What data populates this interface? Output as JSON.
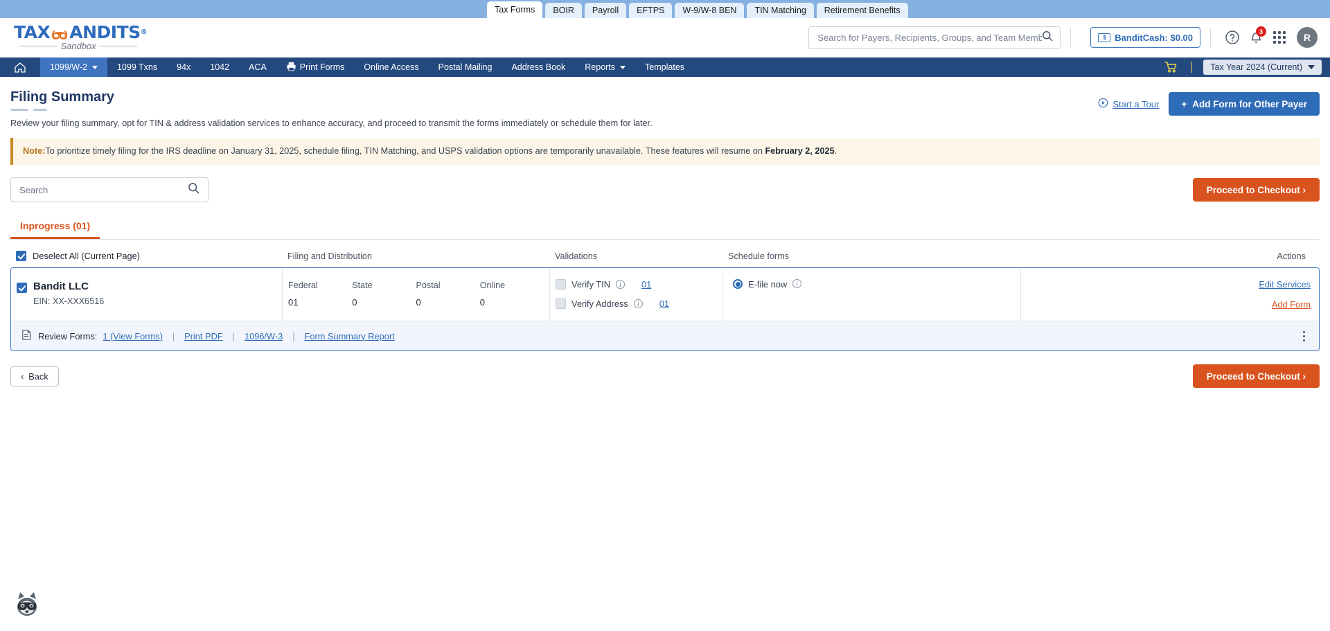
{
  "browser_tabs": [
    {
      "label": "Tax Forms",
      "active": true
    },
    {
      "label": "BOIR",
      "active": false
    },
    {
      "label": "Payroll",
      "active": false
    },
    {
      "label": "EFTPS",
      "active": false
    },
    {
      "label": "W-9/W-8 BEN",
      "active": false
    },
    {
      "label": "TIN Matching",
      "active": false
    },
    {
      "label": "Retirement Benefits",
      "active": false
    }
  ],
  "header": {
    "logo_text": "TAXBANDITS",
    "logo_registered": "®",
    "logo_sub": "Sandbox",
    "search_placeholder": "Search for Payers, Recipients, Groups, and Team Members",
    "search_value": "",
    "bandit_cash_label": "BanditCash: $0.00",
    "bandit_cash_icon_text": "$",
    "notification_count": "3",
    "avatar_initial": "R"
  },
  "nav": {
    "items": [
      {
        "label": "1099/W-2",
        "active": true,
        "caret": true
      },
      {
        "label": "1099 Txns",
        "active": false,
        "caret": false
      },
      {
        "label": "94x",
        "active": false,
        "caret": false
      },
      {
        "label": "1042",
        "active": false,
        "caret": false
      },
      {
        "label": "ACA",
        "active": false,
        "caret": false
      },
      {
        "label": "Print Forms",
        "active": false,
        "caret": false,
        "icon": "printer-icon"
      },
      {
        "label": "Online Access",
        "active": false,
        "caret": false
      },
      {
        "label": "Postal Mailing",
        "active": false,
        "caret": false
      },
      {
        "label": "Address Book",
        "active": false,
        "caret": false
      },
      {
        "label": "Reports",
        "active": false,
        "caret": true
      },
      {
        "label": "Templates",
        "active": false,
        "caret": false
      }
    ],
    "tax_year_label": "Tax Year 2024 (Current)"
  },
  "page": {
    "title": "Filing Summary",
    "subtitle": "Review your filing summary, opt for TIN & address validation services to enhance accuracy, and proceed to transmit the forms immediately or schedule them for later.",
    "tour_label": "Start a Tour",
    "add_form_label": "Add Form for Other Payer",
    "add_form_plus": "+",
    "note_label": "Note:",
    "note_text_1": "To prioritize timely filing for the IRS deadline on January 31, 2025, schedule filing, TIN Matching, and USPS validation options are temporarily unavailable. These features will resume on ",
    "note_date": "February 2, 2025",
    "note_text_2": "."
  },
  "toolbar": {
    "search_placeholder": "Search",
    "search_value": "",
    "checkout_label": "Proceed to Checkout ›"
  },
  "tabs": [
    {
      "label": "Inprogress",
      "count": "(01)",
      "active": true
    }
  ],
  "table": {
    "headers": {
      "select_all": "Deselect All (Current Page)",
      "filing": "Filing and Distribution",
      "validations": "Validations",
      "schedule": "Schedule forms",
      "actions": "Actions"
    },
    "rows": [
      {
        "selected": true,
        "payer_name": "Bandit LLC",
        "payer_ein": "EIN: XX-XXX6516",
        "filing": [
          {
            "label": "Federal",
            "value": "01"
          },
          {
            "label": "State",
            "value": "0"
          },
          {
            "label": "Postal",
            "value": "0"
          },
          {
            "label": "Online",
            "value": "0"
          }
        ],
        "validations": [
          {
            "label": "Verify TIN",
            "checked": false,
            "count": "01"
          },
          {
            "label": "Verify Address",
            "checked": false,
            "count": "01"
          }
        ],
        "schedule": {
          "label": "E-file now",
          "selected": true
        },
        "actions": [
          {
            "label": "Edit Services",
            "style": "blue"
          },
          {
            "label": "Add Form",
            "style": "orange"
          }
        ],
        "footer": {
          "review_label": "Review Forms:",
          "links": [
            {
              "label": "1 (View Forms)"
            },
            {
              "label": "Print PDF"
            },
            {
              "label": "1096/W-3"
            },
            {
              "label": "Form Summary Report"
            }
          ]
        }
      }
    ]
  },
  "bottom": {
    "back_label": "Back",
    "back_caret": "‹",
    "checkout_label": "Proceed to Checkout ›"
  }
}
